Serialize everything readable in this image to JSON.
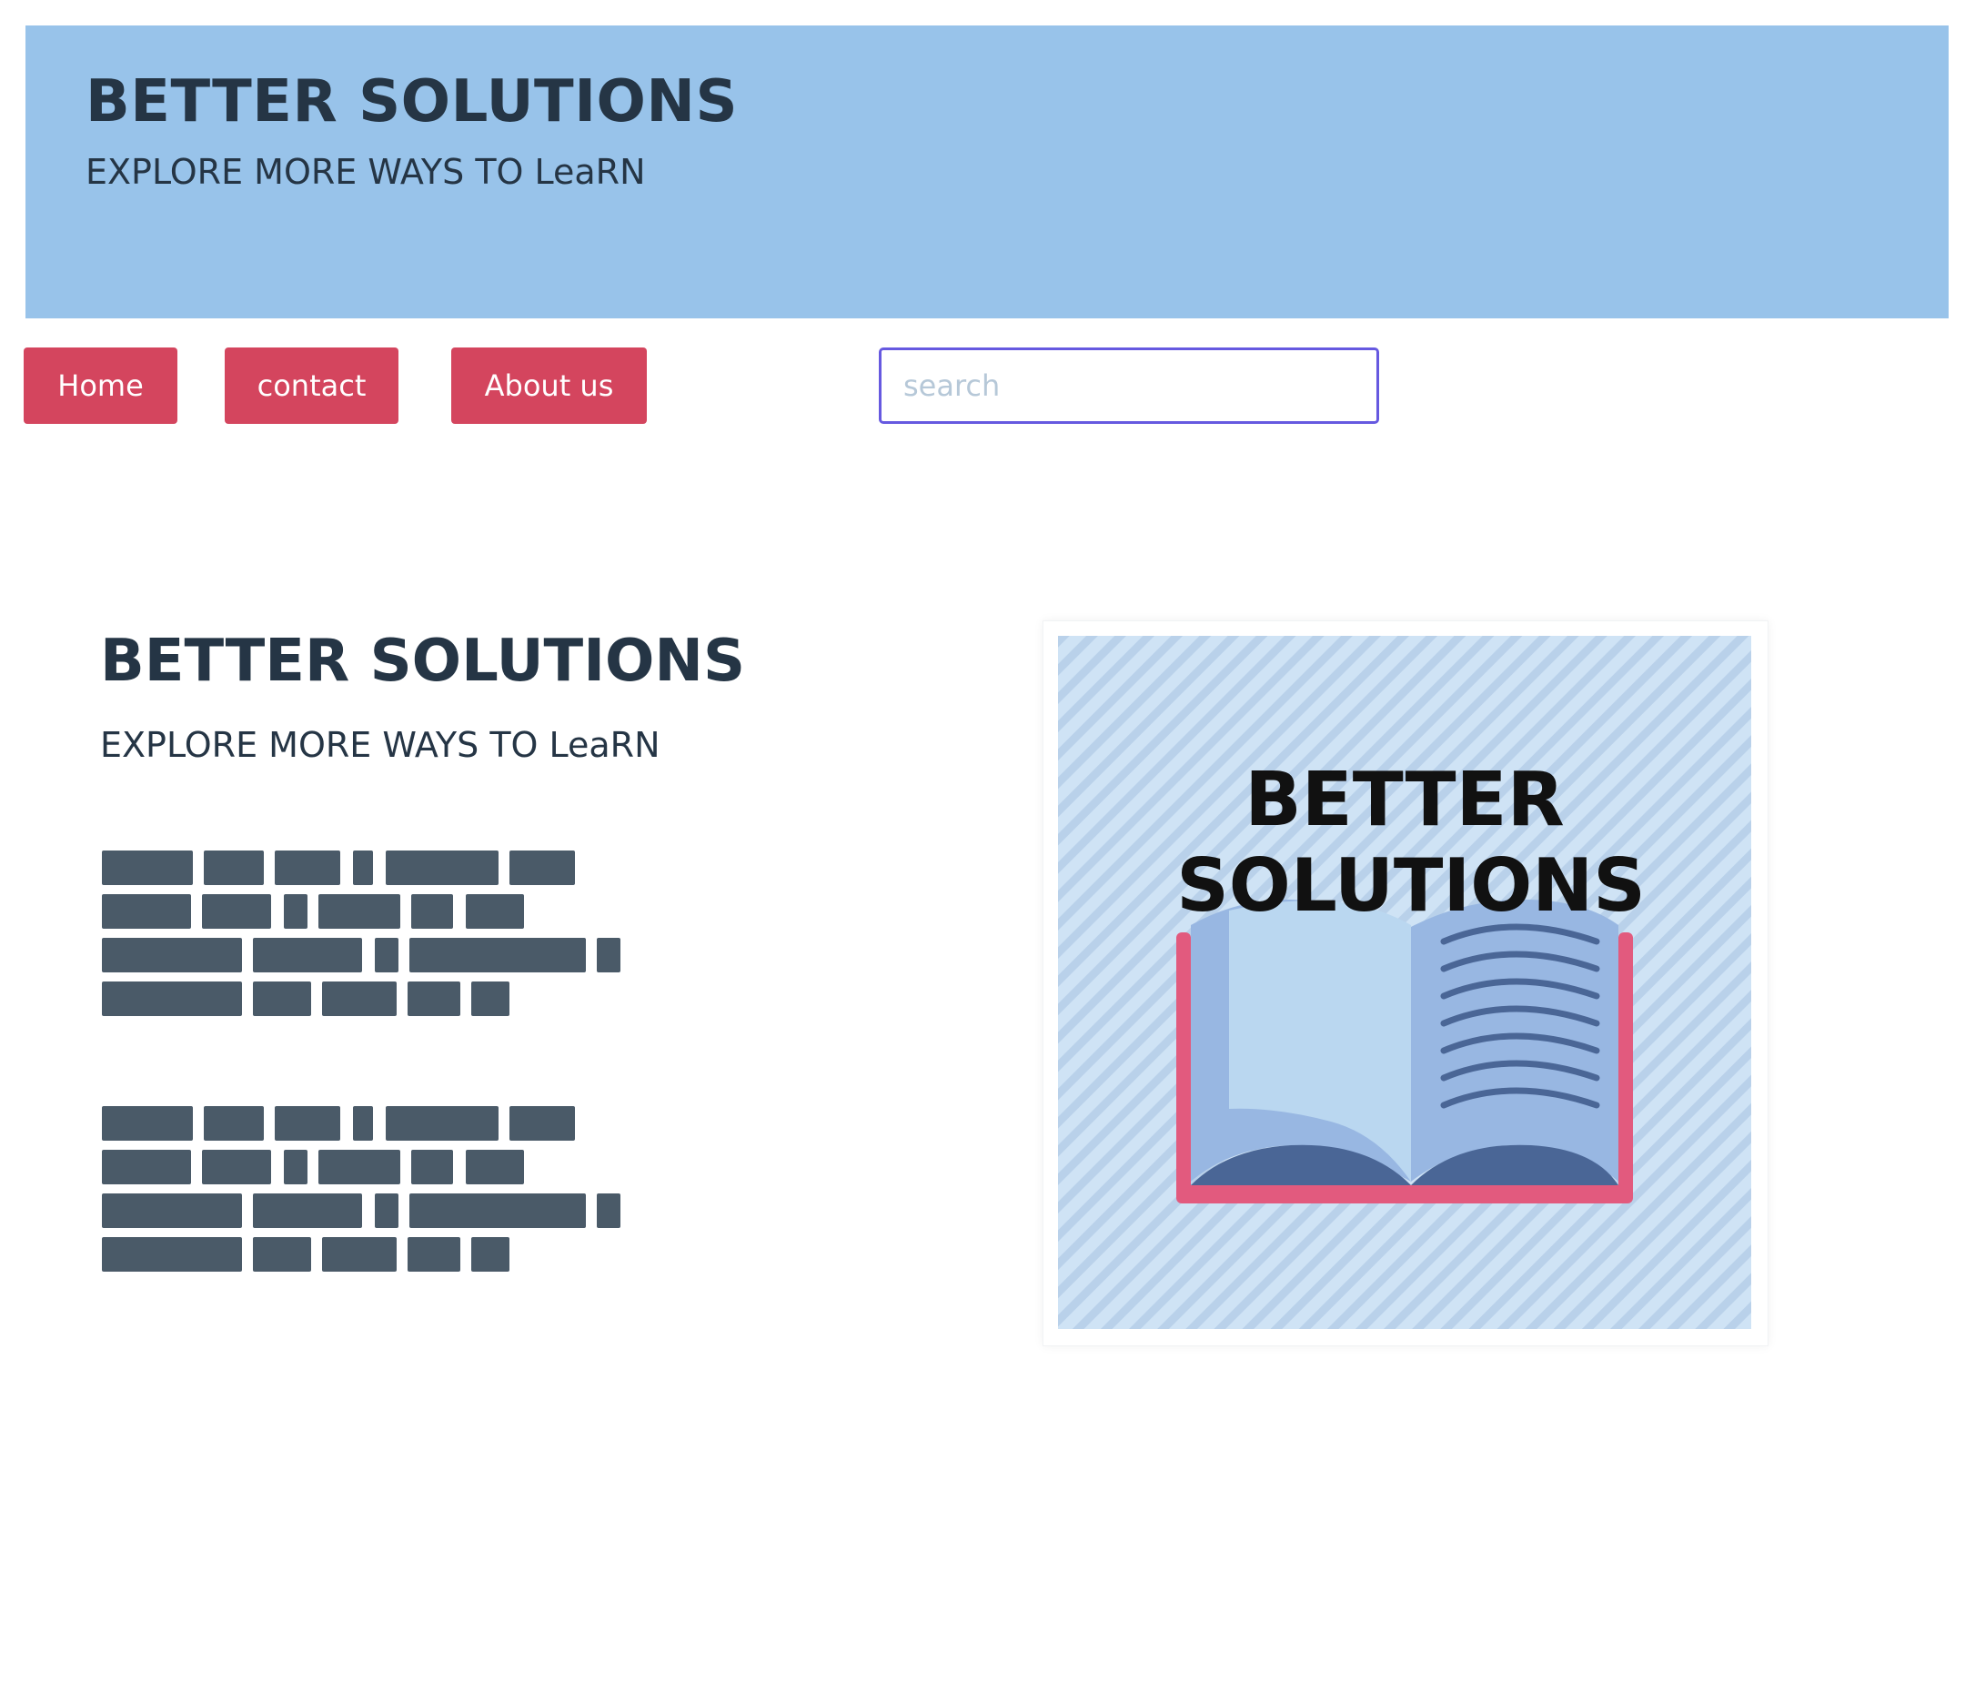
{
  "header": {
    "title": "BETTER SOLUTIONS",
    "subtitle": "EXPLORE MORE WAYS TO LeaRN"
  },
  "nav": {
    "items": [
      {
        "label": "Home"
      },
      {
        "label": "contact"
      },
      {
        "label": "About us"
      }
    ],
    "search": {
      "placeholder": "search",
      "value": ""
    }
  },
  "main": {
    "title": "BETTER SOLUTIONS",
    "subtitle": "EXPLORE MORE WAYS TO LeaRN",
    "logo": {
      "line1": "BETTER",
      "line2": "SOLUTIONS",
      "icon": "open-book-icon"
    }
  },
  "colors": {
    "banner": "#98c3ea",
    "nav_button": "#d4455e",
    "search_focus_border": "#6659e0",
    "heading_text": "#253545",
    "redacted_text": "#4a5a68",
    "logo_background": "#cfe3f5",
    "logo_stripe": "#b9d1ea",
    "book_cover": "#e25a7e",
    "book_page": "#bad7f0",
    "book_page_shade": "#98b7e2",
    "book_spine": "#4a6696"
  }
}
